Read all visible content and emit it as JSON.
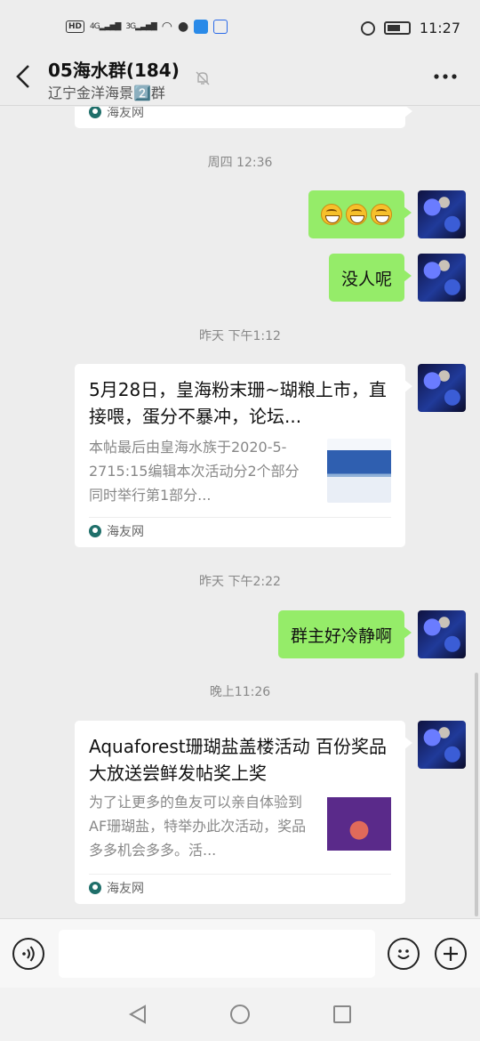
{
  "status_bar": {
    "left_labels": [
      "HD",
      "4G",
      "3G"
    ],
    "time": "11:27"
  },
  "header": {
    "title": "05海水群(184)",
    "subtitle": "辽宁金洋海景2️⃣群"
  },
  "messages": {
    "top_card_source": "海友网",
    "time1": "周四 12:36",
    "msg1_emoji_count": 3,
    "msg2": "没人呢",
    "time2": "昨天 下午1:12",
    "card1": {
      "title": "5月28日，皇海粉末珊~瑚粮上市，直接喂，蛋分不暴冲，论坛...",
      "desc": "本帖最后由皇海水族于2020-5-2715:15编辑本次活动分2个部分同时举行第1部分...",
      "source": "海友网"
    },
    "time3": "昨天 下午2:22",
    "msg3": "群主好冷静啊",
    "time4": "晚上11:26",
    "card2": {
      "title": "Aquaforest珊瑚盐盖楼活动 百份奖品大放送尝鲜发帖奖上奖",
      "desc": "为了让更多的鱼友可以亲自体验到AF珊瑚盐，特举办此次活动，奖品多多机会多多。活...",
      "source": "海友网"
    }
  },
  "input": {
    "placeholder": ""
  },
  "icons": {
    "back": "chevron-left-icon",
    "mute": "bell-off-icon",
    "more": "more-icon",
    "voice": "voice-icon",
    "emoji": "emoji-icon",
    "plus": "plus-icon"
  }
}
